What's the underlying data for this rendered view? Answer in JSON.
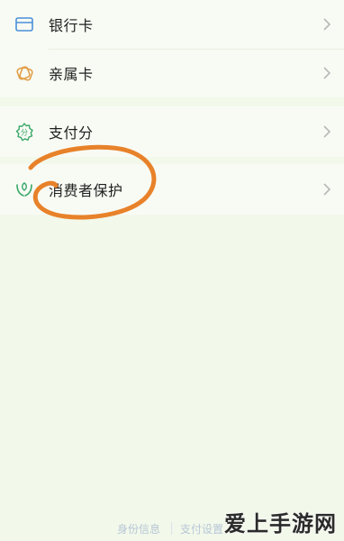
{
  "menu": {
    "items": [
      {
        "label": "银行卡",
        "icon": "bank-card-icon"
      },
      {
        "label": "亲属卡",
        "icon": "family-card-icon"
      },
      {
        "label": "支付分",
        "icon": "payment-score-icon"
      },
      {
        "label": "消费者保护",
        "icon": "consumer-protection-icon"
      }
    ]
  },
  "footer": {
    "links": [
      "身份信息",
      "支付设置"
    ]
  },
  "watermark": "爱上手游网",
  "colors": {
    "icon_blue": "#4a90d9",
    "icon_orange": "#e2a04a",
    "icon_green": "#3aa86a",
    "annotation_orange": "#e8822a",
    "background": "#f2f8ea"
  }
}
